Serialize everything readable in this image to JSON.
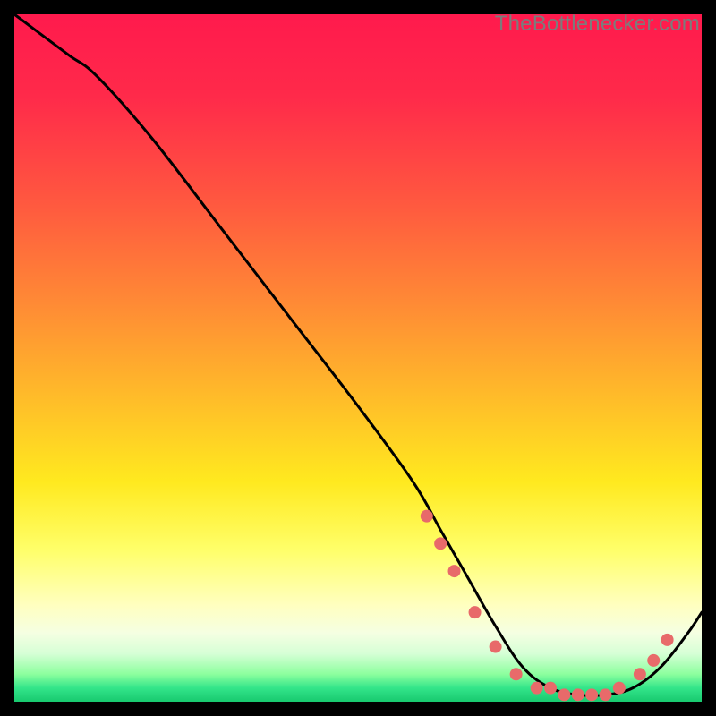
{
  "watermark": "TheBottlenecker.com",
  "chart_data": {
    "type": "line",
    "title": "",
    "xlabel": "",
    "ylabel": "",
    "xlim": [
      0,
      100
    ],
    "ylim": [
      0,
      100
    ],
    "curve": {
      "name": "bottleneck-curve",
      "x": [
        0,
        4,
        8,
        12,
        20,
        30,
        40,
        50,
        58,
        62,
        66,
        70,
        74,
        78,
        82,
        86,
        90,
        94,
        98,
        100
      ],
      "y": [
        100,
        97,
        94,
        91,
        82,
        69,
        56,
        43,
        32,
        25,
        18,
        11,
        5,
        2,
        1,
        1,
        2,
        5,
        10,
        13
      ]
    },
    "highlight_points": {
      "name": "curve-dots",
      "x": [
        60,
        62,
        64,
        67,
        70,
        73,
        76,
        78,
        80,
        82,
        84,
        86,
        88,
        91,
        93,
        95
      ],
      "y": [
        27,
        23,
        19,
        13,
        8,
        4,
        2,
        2,
        1,
        1,
        1,
        1,
        2,
        4,
        6,
        9
      ]
    }
  }
}
